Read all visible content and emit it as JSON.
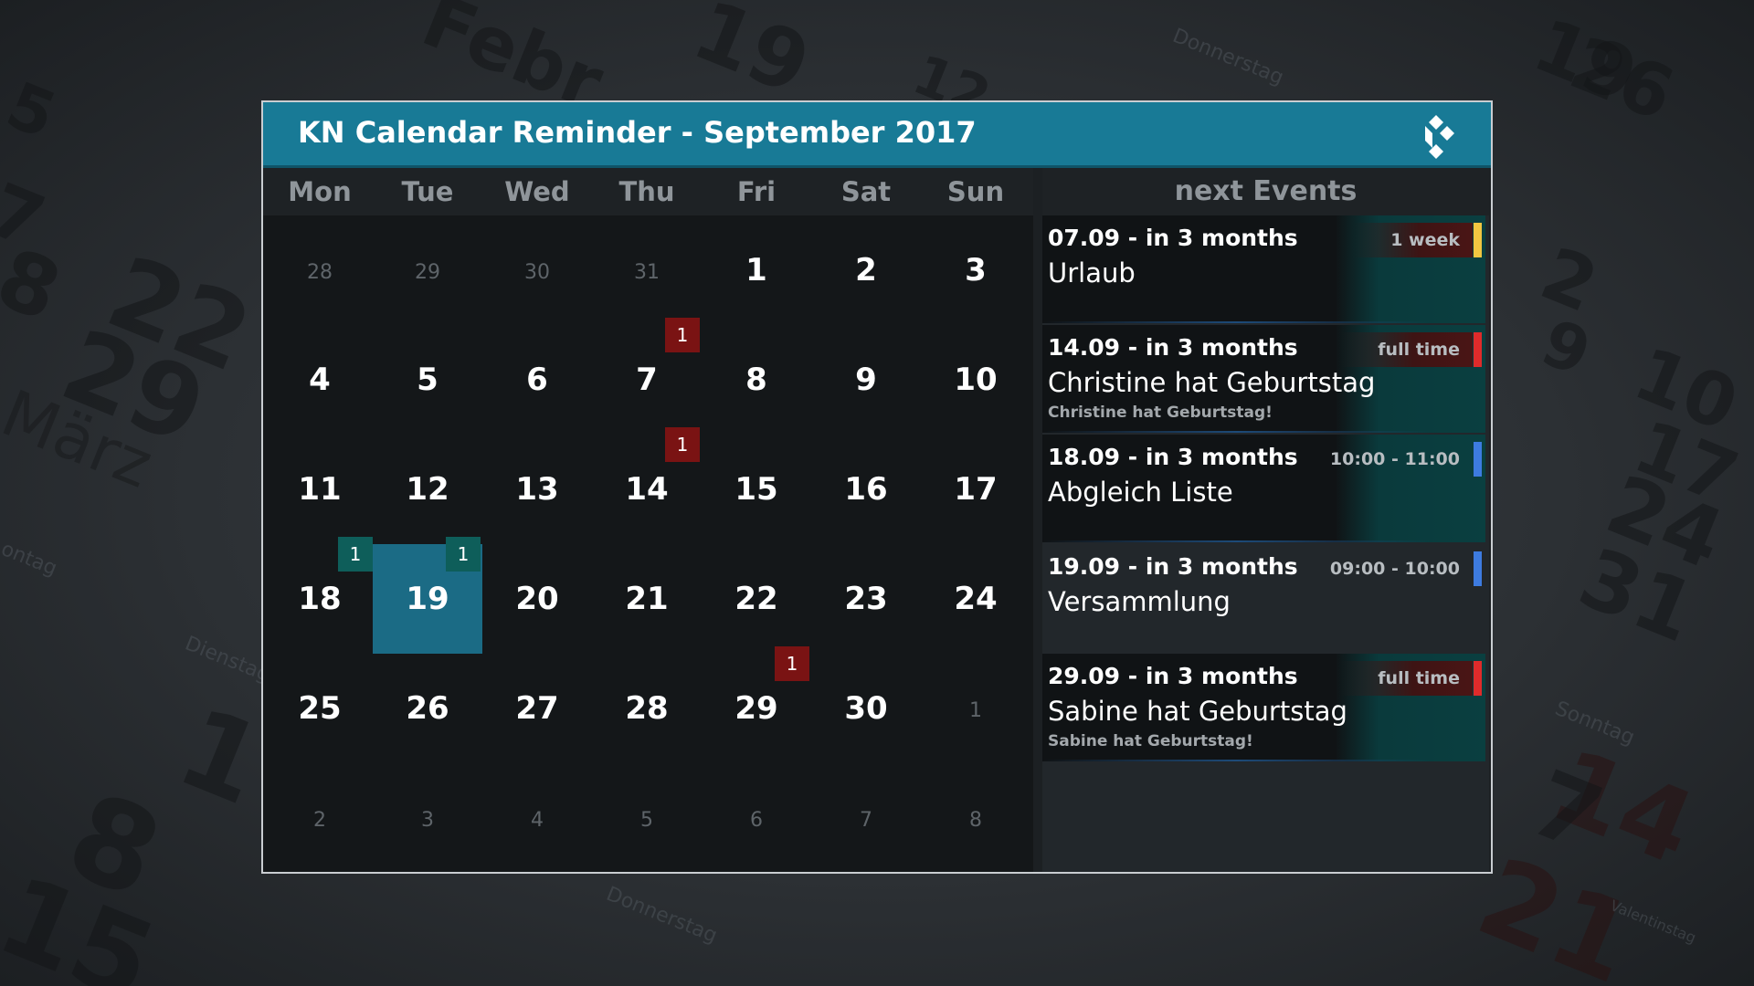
{
  "window": {
    "title": "KN Calendar Reminder - September 2017"
  },
  "icons": {
    "logo": "kodi-logo-icon"
  },
  "colors": {
    "titlebar": "#187a96",
    "today": "#1b6b85",
    "badge_red": "#7a1313",
    "badge_teal": "#0e5e5a",
    "bar_yellow": "#f2c641",
    "bar_red": "#e02b2b",
    "bar_blue": "#3d7be0"
  },
  "calendar": {
    "weekdays": [
      "Mon",
      "Tue",
      "Wed",
      "Thu",
      "Fri",
      "Sat",
      "Sun"
    ],
    "weeks": [
      [
        {
          "d": "28",
          "other": true
        },
        {
          "d": "29",
          "other": true
        },
        {
          "d": "30",
          "other": true
        },
        {
          "d": "31",
          "other": true
        },
        {
          "d": "1"
        },
        {
          "d": "2"
        },
        {
          "d": "3"
        }
      ],
      [
        {
          "d": "4"
        },
        {
          "d": "5"
        },
        {
          "d": "6"
        },
        {
          "d": "7",
          "badge": "1",
          "badge_color": "red"
        },
        {
          "d": "8"
        },
        {
          "d": "9"
        },
        {
          "d": "10"
        }
      ],
      [
        {
          "d": "11"
        },
        {
          "d": "12"
        },
        {
          "d": "13"
        },
        {
          "d": "14",
          "badge": "1",
          "badge_color": "red"
        },
        {
          "d": "15"
        },
        {
          "d": "16"
        },
        {
          "d": "17"
        }
      ],
      [
        {
          "d": "18",
          "badge": "1",
          "badge_color": "teal"
        },
        {
          "d": "19",
          "today": true,
          "badge": "1",
          "badge_color": "teal"
        },
        {
          "d": "20"
        },
        {
          "d": "21"
        },
        {
          "d": "22"
        },
        {
          "d": "23"
        },
        {
          "d": "24"
        }
      ],
      [
        {
          "d": "25"
        },
        {
          "d": "26"
        },
        {
          "d": "27"
        },
        {
          "d": "28"
        },
        {
          "d": "29",
          "badge": "1",
          "badge_color": "red"
        },
        {
          "d": "30"
        },
        {
          "d": "1",
          "other": true
        }
      ],
      [
        {
          "d": "2",
          "other": true
        },
        {
          "d": "3",
          "other": true
        },
        {
          "d": "4",
          "other": true
        },
        {
          "d": "5",
          "other": true
        },
        {
          "d": "6",
          "other": true
        },
        {
          "d": "7",
          "other": true
        },
        {
          "d": "8",
          "other": true
        }
      ]
    ]
  },
  "events": {
    "heading": "next Events",
    "items": [
      {
        "date": "07.09 - in 3 months",
        "name": "Urlaub",
        "desc": "",
        "tag": "1 week",
        "tag_style": "red",
        "bar": "#f2c641"
      },
      {
        "date": "14.09 - in 3 months",
        "name": "Christine hat Geburtstag",
        "desc": "Christine hat Geburtstag!",
        "tag": "full time",
        "tag_style": "red",
        "bar": "#e02b2b"
      },
      {
        "date": "18.09 - in 3 months",
        "name": "Abgleich Liste",
        "desc": "",
        "tag": "10:00 - 11:00",
        "tag_style": "dark",
        "bar": "#3d7be0"
      },
      {
        "date": "19.09 - in 3 months",
        "name": "Versammlung",
        "desc": "",
        "tag": "09:00 - 10:00",
        "tag_style": "dark",
        "bar": "#3d7be0",
        "plain": true
      },
      {
        "date": "29.09 - in 3 months",
        "name": "Sabine hat Geburtstag",
        "desc": "Sabine hat Geburtstag!",
        "tag": "full time",
        "tag_style": "red",
        "bar": "#e02b2b"
      }
    ]
  }
}
